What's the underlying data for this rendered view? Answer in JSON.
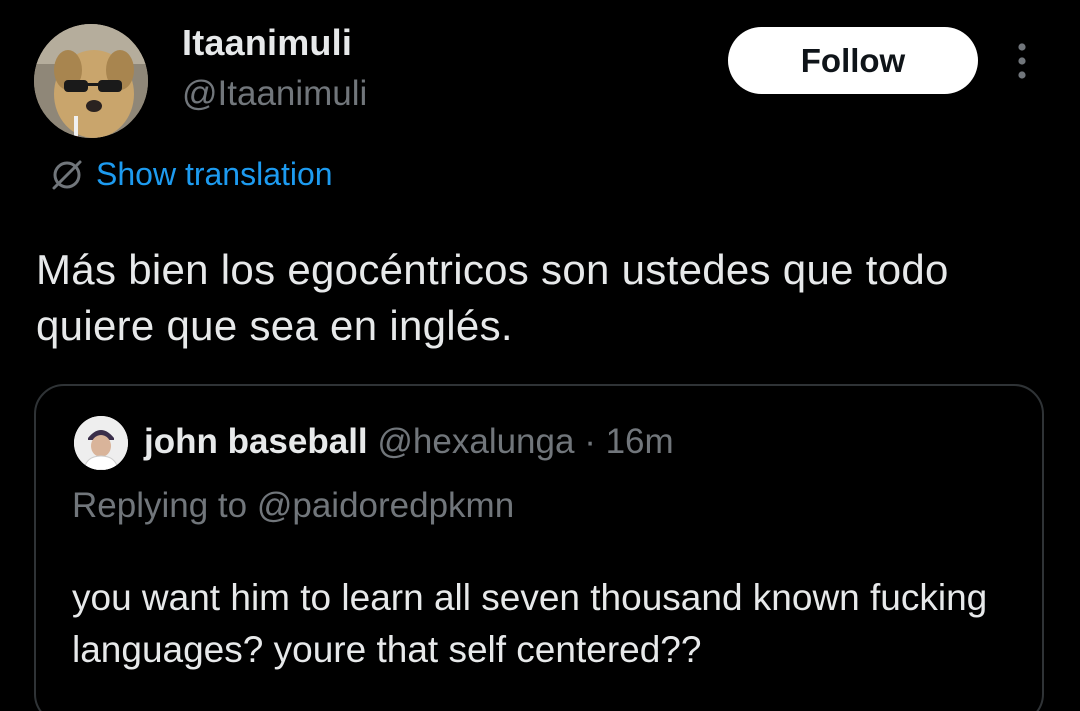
{
  "tweet": {
    "author": {
      "display_name": "Itaanimuli",
      "handle": "@Itaanimuli",
      "avatar_icon": "dog-with-sunglasses-avatar"
    },
    "follow_label": "Follow",
    "more_icon": "more-vertical-icon",
    "translation": {
      "icon": "translate-icon",
      "label": "Show translation"
    },
    "text": "Más bien los egocéntricos son ustedes que todo quiere que sea en inglés."
  },
  "quote": {
    "author": {
      "display_name": "john baseball",
      "handle": "@hexalunga",
      "separator": "·",
      "time": "16m",
      "avatar_icon": "baseball-player-avatar"
    },
    "replying_to": "Replying to @paidoredpkmn",
    "text": "you want him to learn all seven thousand known fucking languages? youre that self centered??"
  },
  "colors": {
    "background": "#000000",
    "primary_text": "#e7e9ea",
    "secondary_text": "#71767b",
    "link": "#1d9bf0",
    "border": "#2f3336",
    "button_bg": "#ffffff"
  }
}
